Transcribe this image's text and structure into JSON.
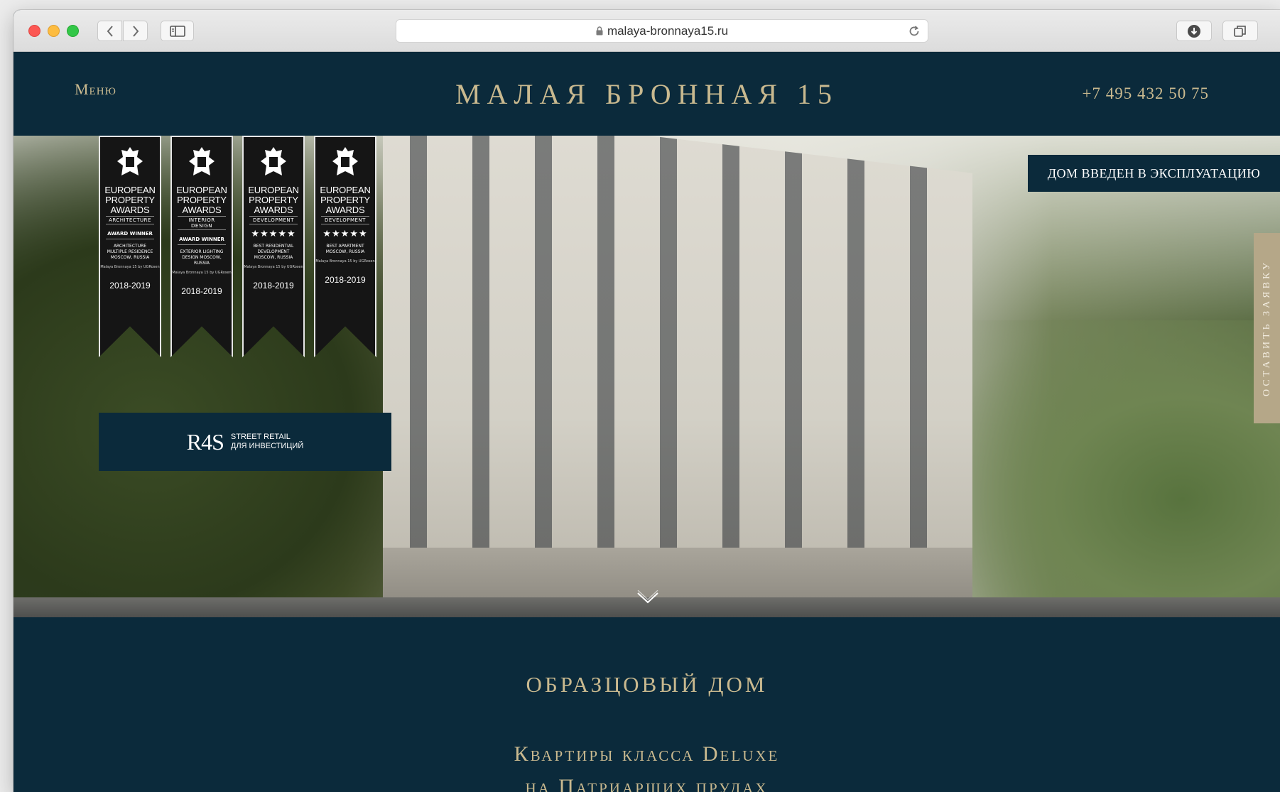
{
  "browser": {
    "url": "malaya-bronnaya15.ru"
  },
  "header": {
    "menu_label": "Меню",
    "title": "МАЛАЯ БРОННАЯ 15",
    "phone": "+7 495 432 50 75"
  },
  "hero": {
    "status_badge": "ДОМ ВВЕДЕН В ЭКСПЛУАТАЦИЮ",
    "side_tab": "ОСТАВИТЬ ЗАЯВКУ",
    "awards": [
      {
        "line1": "EUROPEAN",
        "line2": "PROPERTY",
        "line3": "AWARDS",
        "category": "ARCHITECTURE",
        "winner": "AWARD WINNER",
        "stars": "",
        "description": "ARCHITECTURE MULTIPLE RESIDENCE MOSCOW, RUSSIA",
        "subtext": "Malaya Bronnaya 15 by UGRosen",
        "year": "2018-2019"
      },
      {
        "line1": "EUROPEAN",
        "line2": "PROPERTY",
        "line3": "AWARDS",
        "category": "INTERIOR DESIGN",
        "winner": "AWARD WINNER",
        "stars": "",
        "description": "EXTERIOR LIGHTING DESIGN MOSCOW, RUSSIA",
        "subtext": "Malaya Bronnaya 15 by UGRosen",
        "year": "2018-2019"
      },
      {
        "line1": "EUROPEAN",
        "line2": "PROPERTY",
        "line3": "AWARDS",
        "category": "DEVELOPMENT",
        "winner": "",
        "stars": "★★★★★",
        "description": "BEST RESIDENTIAL DEVELOPMENT MOSCOW, RUSSIA",
        "subtext": "Malaya Bronnaya 15 by UGRosen",
        "year": "2018-2019"
      },
      {
        "line1": "EUROPEAN",
        "line2": "PROPERTY",
        "line3": "AWARDS",
        "category": "DEVELOPMENT",
        "winner": "",
        "stars": "★★★★★",
        "description": "BEST APARTMENT MOSCOW, RUSSIA",
        "subtext": "Malaya Bronnaya 15 by UGRosen",
        "year": "2018-2019"
      }
    ],
    "r4s": {
      "logo": "R4S",
      "line1": "STREET RETAIL",
      "line2": "ДЛЯ ИНВЕСТИЦИЙ"
    }
  },
  "content": {
    "section_title": "ОБРАЗЦОВЫЙ ДОМ",
    "tagline_line1": "Квартиры класса Deluxe",
    "tagline_line2": "на Патриарших прудах"
  },
  "colors": {
    "navy": "#0b2a3b",
    "gold": "#c9b98f",
    "side_tab": "#b5a788"
  }
}
